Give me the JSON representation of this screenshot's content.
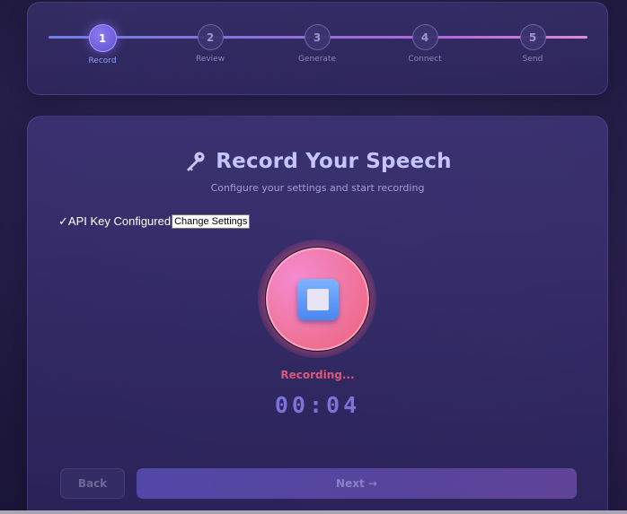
{
  "stepper": {
    "steps": [
      {
        "number": "1",
        "label": "Record",
        "active": true
      },
      {
        "number": "2",
        "label": "Review",
        "active": false
      },
      {
        "number": "3",
        "label": "Generate",
        "active": false
      },
      {
        "number": "4",
        "label": "Connect",
        "active": false
      },
      {
        "number": "5",
        "label": "Send",
        "active": false
      }
    ]
  },
  "header": {
    "icon": "key-icon",
    "title": "Record Your Speech",
    "subtitle": "Configure your settings and start recording"
  },
  "api": {
    "status": "✓API Key Configured",
    "change_label": "Change Settings"
  },
  "recorder": {
    "button_icon": "stop-icon",
    "status": "Recording...",
    "timer": "00:04"
  },
  "nav": {
    "back_label": "Back",
    "next_label": "Next →"
  },
  "colors": {
    "accent": "#7d72d8",
    "recording": "#d85a7a",
    "record_button": "#f07aa8"
  }
}
